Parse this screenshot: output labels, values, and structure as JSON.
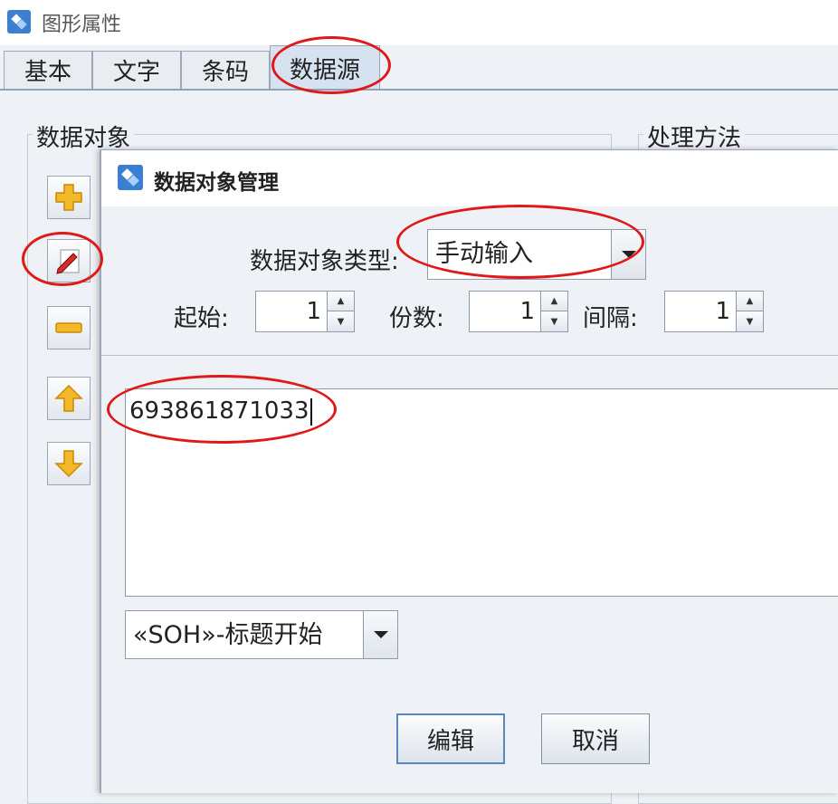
{
  "window": {
    "title": "图形属性"
  },
  "tabs": [
    {
      "label": "基本"
    },
    {
      "label": "文字"
    },
    {
      "label": "条码"
    },
    {
      "label": "数据源"
    }
  ],
  "groups": {
    "data_objects": "数据对象",
    "processing": "处理方法"
  },
  "sidebar": {
    "buttons": [
      {
        "name": "add",
        "icon": "plus-icon"
      },
      {
        "name": "edit",
        "icon": "pencil-edit-icon"
      },
      {
        "name": "remove",
        "icon": "minus-icon"
      },
      {
        "name": "move_up",
        "icon": "arrow-up-icon"
      },
      {
        "name": "move_down",
        "icon": "arrow-down-icon"
      }
    ]
  },
  "dialog": {
    "title": "数据对象管理",
    "type_label": "数据对象类型:",
    "type_value": "手动输入",
    "start_label": "起始:",
    "start_value": "1",
    "copies_label": "份数:",
    "copies_value": "1",
    "interval_label": "间隔:",
    "interval_value": "1",
    "text_value": "693861871033",
    "control_char_value": "«SOH»-标题开始",
    "edit_button": "编辑",
    "cancel_button": "取消"
  },
  "colors": {
    "highlight_circle": "#e01818",
    "accent_border": "#5b87c1"
  }
}
